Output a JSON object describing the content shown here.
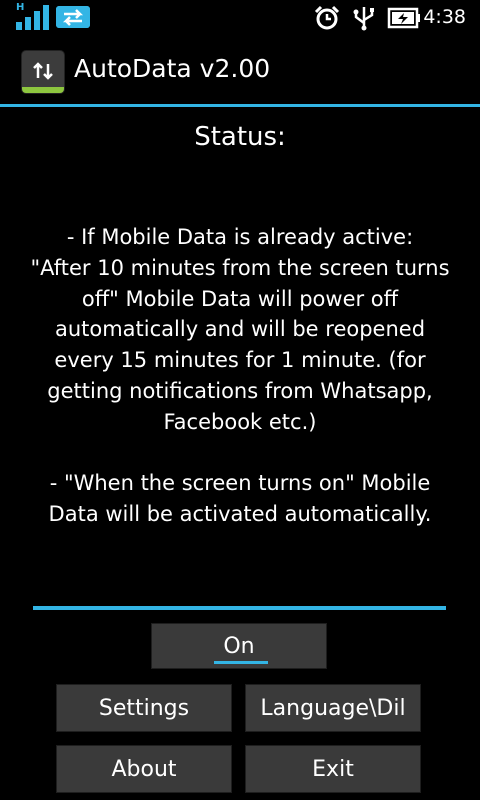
{
  "statusbar": {
    "network_type": "H",
    "time": "4:38"
  },
  "app": {
    "title": "AutoData v2.00"
  },
  "content": {
    "heading": "Status:",
    "text": "- If Mobile Data is already active:\n\"After 10 minutes from the screen turns off\" Mobile Data will power off automatically and will be reopened every 15 minutes for 1 minute. (for getting notifications from Whatsapp, Facebook etc.)\n\n- \"When the screen turns on\" Mobile Data will be activated automatically."
  },
  "buttons": {
    "on": "On",
    "settings": "Settings",
    "language": "Language\\Dil",
    "about": "About",
    "exit": "Exit"
  },
  "colors": {
    "accent": "#33b5e5",
    "button_bg": "#3a3a3a",
    "background": "#000000"
  }
}
